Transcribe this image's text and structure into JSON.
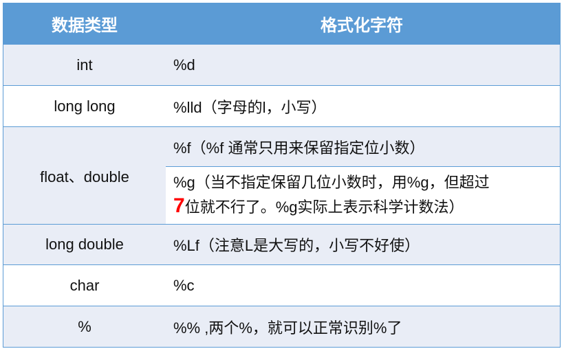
{
  "header": {
    "col1": "数据类型",
    "col2": "格式化字符"
  },
  "rows": [
    {
      "type": "int",
      "format": "%d"
    },
    {
      "type": "long long",
      "format": "%lld（字母的l，小写）"
    },
    {
      "type": "float、double",
      "format_f": "%f（%f   通常只用来保留指定位小数）",
      "format_g_line1": "%g（当不指定保留几位小数时，用%g，但超过",
      "format_g_highlight": "7",
      "format_g_line2": "位就不行了。%g实际上表示科学计数法）"
    },
    {
      "type": "long double",
      "format": "%Lf（注意L是大写的，小写不好使）"
    },
    {
      "type": "char",
      "format": "%c"
    },
    {
      "type": "%",
      "format": "%% ,两个%，就可以正常识别%了"
    }
  ],
  "colors": {
    "header_bg": "#5b9bd5",
    "band_bg": "#e9edf6",
    "highlight": "#ff0000"
  }
}
